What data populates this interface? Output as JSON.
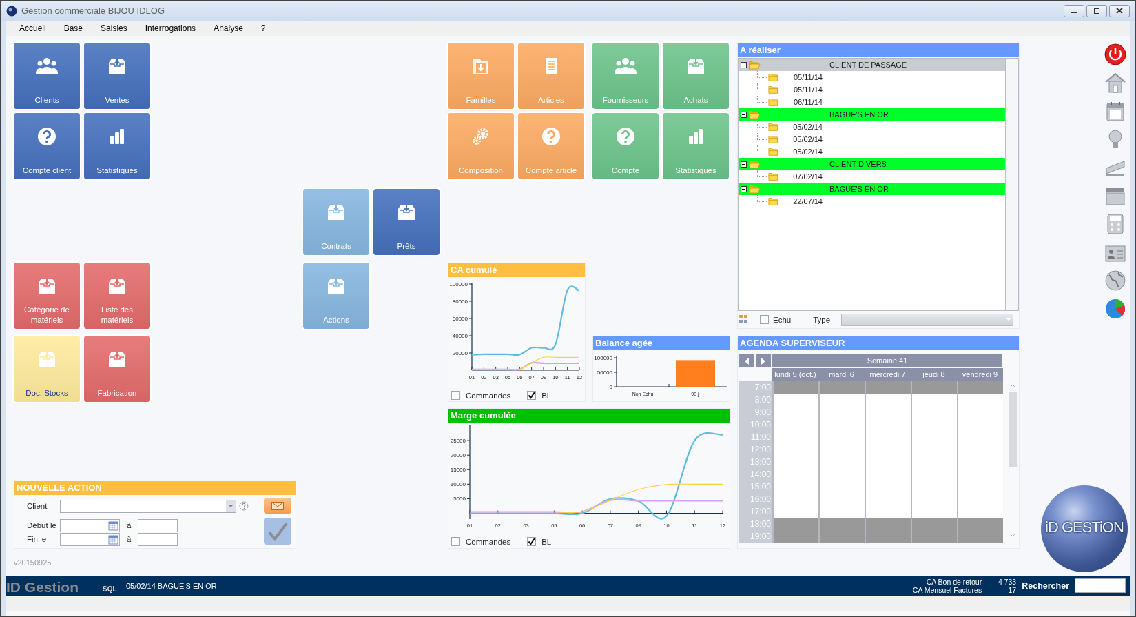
{
  "window": {
    "title": "Gestion commerciale BIJOU IDLOG"
  },
  "menu": [
    {
      "label": "Accueil"
    },
    {
      "label": "Base"
    },
    {
      "label": "Saisies"
    },
    {
      "label": "Interrogations"
    },
    {
      "label": "Analyse"
    },
    {
      "label": "?"
    }
  ],
  "tiles": [
    {
      "label": "Clients",
      "kind": "users",
      "color": "#4470bd"
    },
    {
      "label": "Ventes",
      "kind": "inbox",
      "color": "#4470bd"
    },
    {
      "label": "Familles",
      "kind": "folder",
      "color": "#fcaa62"
    },
    {
      "label": "Articles",
      "kind": "document",
      "color": "#fcaa62"
    },
    {
      "label": "Fournisseurs",
      "kind": "users",
      "color": "#6cc48a"
    },
    {
      "label": "Achats",
      "kind": "inbox",
      "color": "#6cc48a"
    },
    {
      "label": "Compte client",
      "kind": "help",
      "color": "#4470bd"
    },
    {
      "label": "Statistiques",
      "kind": "bars",
      "color": "#4470bd"
    },
    {
      "label": "Composition",
      "kind": "gears",
      "color": "#fcaa62"
    },
    {
      "label": "Compte article",
      "kind": "help",
      "color": "#fcaa62"
    },
    {
      "label": "Compte",
      "kind": "help",
      "color": "#6cc48a"
    },
    {
      "label": "Statistiques",
      "kind": "bars",
      "color": "#6cc48a"
    },
    {
      "label": "Contrats",
      "kind": "inbox",
      "color": "#86b6e0"
    },
    {
      "label": "Prêts",
      "kind": "inbox",
      "color": "#4470bd"
    },
    {
      "label": "Catégorie de matériels",
      "kind": "inbox",
      "color": "#e46a6a"
    },
    {
      "label": "Liste des matériels",
      "kind": "inbox",
      "color": "#e46a6a"
    },
    {
      "label": "Actions",
      "kind": "inbox",
      "color": "#86b6e0"
    },
    {
      "label": "Doc. Stocks",
      "kind": "inbox",
      "color": "#ffeb9c"
    },
    {
      "label": "Fabrication",
      "kind": "inbox",
      "color": "#e46a6a"
    }
  ],
  "a_realiser": {
    "title": "A réaliser",
    "groups": [
      {
        "client": "CLIENT DE PASSAGE",
        "expanded": true,
        "highlighted": false,
        "children": [
          {
            "date": "05/11/14"
          },
          {
            "date": "05/11/14"
          },
          {
            "date": "06/11/14"
          }
        ]
      },
      {
        "client": "BAGUE'S EN OR",
        "expanded": true,
        "highlighted": true,
        "children": [
          {
            "date": "05/02/14"
          },
          {
            "date": "05/02/14"
          },
          {
            "date": "05/02/14"
          }
        ]
      },
      {
        "client": "CLIENT DIVERS",
        "expanded": true,
        "highlighted": true,
        "children": [
          {
            "date": "07/02/14"
          }
        ]
      },
      {
        "client": "BAGUE'S EN OR",
        "expanded": true,
        "highlighted": true,
        "children": [
          {
            "date": "22/07/14"
          }
        ]
      }
    ],
    "echu": {
      "label": "Echu",
      "checked": false
    },
    "type_label": "Type"
  },
  "ca_cumule": {
    "title": "CA cumulé",
    "chart_data": {
      "type": "line",
      "categories": [
        "01",
        "02",
        "03",
        "05",
        "06",
        "07",
        "09",
        "10",
        "11",
        "12"
      ],
      "ylim": [
        0,
        100000
      ],
      "yticks": [
        20000,
        40000,
        60000,
        80000,
        100000
      ],
      "series": [
        {
          "color": "#5bbde0",
          "values": [
            18000,
            18500,
            18500,
            18500,
            18000,
            26000,
            26000,
            30000,
            93000,
            92000
          ]
        },
        {
          "color": "#ffd23f",
          "values": [
            1000,
            1000,
            1000,
            1000,
            1000,
            8500,
            15000,
            15000,
            15000,
            15000
          ]
        },
        {
          "color": "#d9a0f0",
          "values": [
            1000,
            1000,
            1000,
            1000,
            1000,
            8500,
            8000,
            8000,
            8000,
            8000
          ]
        }
      ]
    },
    "options": [
      {
        "label": "Commandes",
        "checked": false
      },
      {
        "label": "BL",
        "checked": true
      }
    ]
  },
  "balance_agee": {
    "title": "Balance agée",
    "chart_data": {
      "type": "bar",
      "categories": [
        "Non Echu",
        "90 j"
      ],
      "ylim": [
        0,
        100000
      ],
      "yticks": [
        0,
        50000,
        100000
      ],
      "series": [
        {
          "color": "#ff7f1e",
          "values": [
            0,
            92000
          ]
        }
      ]
    }
  },
  "marge_cumulee": {
    "title": "Marge cumulée",
    "chart_data": {
      "type": "line",
      "categories": [
        "01",
        "02",
        "03",
        "05",
        "06",
        "07",
        "09",
        "10",
        "11",
        "12"
      ],
      "ylim": [
        -2000,
        30000
      ],
      "yticks": [
        5000,
        10000,
        15000,
        20000,
        25000
      ],
      "series": [
        {
          "color": "#5bbde0",
          "values": [
            0,
            0,
            0,
            0,
            0,
            4900,
            4200,
            -1000,
            25000,
            27000
          ]
        },
        {
          "color": "#ffd23f",
          "values": [
            500,
            500,
            500,
            500,
            500,
            4500,
            8200,
            9900,
            10000,
            10000
          ]
        },
        {
          "color": "#d9a0f0",
          "values": [
            500,
            500,
            500,
            500,
            500,
            4500,
            4300,
            4300,
            4300,
            4300
          ]
        }
      ]
    },
    "options": [
      {
        "label": "Commandes",
        "checked": false
      },
      {
        "label": "BL",
        "checked": true
      }
    ]
  },
  "agenda": {
    "title": "AGENDA SUPERVISEUR",
    "week": "Semaine 41",
    "days": [
      "lundi 5 (oct.)",
      "mardi 6",
      "mercredi 7",
      "jeudi 8",
      "vendredi 9"
    ],
    "hours": [
      {
        "time": "7:00",
        "off_hours": true
      },
      {
        "time": "8:00",
        "off_hours": false
      },
      {
        "time": "9:00",
        "off_hours": false
      },
      {
        "time": "10:00",
        "off_hours": false
      },
      {
        "time": "11:00",
        "off_hours": false
      },
      {
        "time": "12:00",
        "off_hours": false
      },
      {
        "time": "13:00",
        "off_hours": false
      },
      {
        "time": "14:00",
        "off_hours": false
      },
      {
        "time": "15:00",
        "off_hours": false
      },
      {
        "time": "16:00",
        "off_hours": false
      },
      {
        "time": "17:00",
        "off_hours": false
      },
      {
        "time": "18:00",
        "off_hours": true
      },
      {
        "time": "19:00",
        "off_hours": true
      }
    ]
  },
  "nouvelle_action": {
    "title": "NOUVELLE ACTION",
    "client_label": "Client",
    "start_label": "Début le",
    "end_label": "Fin le",
    "to_label_1": "à",
    "to_label_2": "à"
  },
  "version": "v20150925",
  "logo": {
    "text": "iD GESTiON"
  },
  "status_bar": {
    "brand": "ID Gestion",
    "mode": "SQL",
    "ticker": "05/02/14 BAGUE'S EN OR",
    "stats": [
      {
        "label": "CA Bon de retour",
        "value": "-4 733"
      },
      {
        "label": "CA Mensuel Factures",
        "value": "17"
      }
    ],
    "search_label": "Rechercher"
  }
}
